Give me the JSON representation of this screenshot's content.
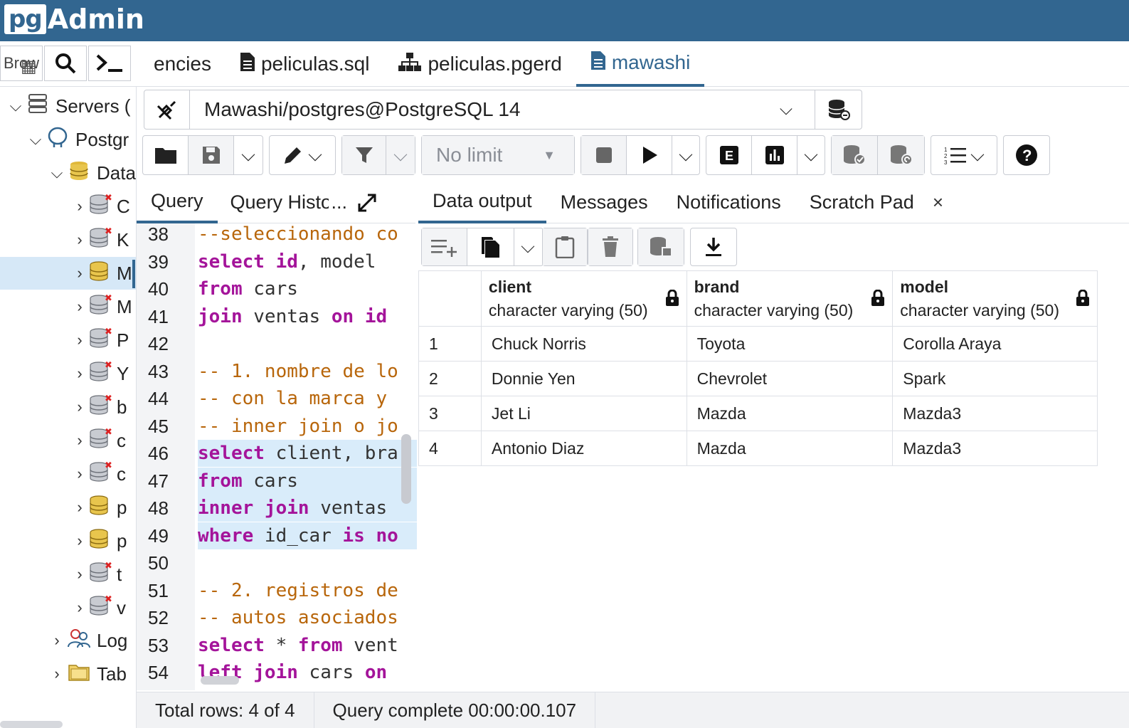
{
  "app": {
    "logo_pg": "pg",
    "logo_admin": "Admin"
  },
  "left_tools": {
    "browse_label": "Brow"
  },
  "tabs": [
    {
      "label": "encies",
      "icon": "none"
    },
    {
      "label": "peliculas.sql",
      "icon": "file-icon"
    },
    {
      "label": "peliculas.pgerd",
      "icon": "erd-icon"
    },
    {
      "label": "mawashi",
      "icon": "file-icon",
      "active": true
    }
  ],
  "tree": [
    {
      "label": "Servers ("
    },
    {
      "label": "Postgr"
    },
    {
      "label": "Data"
    },
    {
      "label": "C"
    },
    {
      "label": "K"
    },
    {
      "label": "M"
    },
    {
      "label": "M"
    },
    {
      "label": "P"
    },
    {
      "label": "Y"
    },
    {
      "label": "b"
    },
    {
      "label": "c"
    },
    {
      "label": "c"
    },
    {
      "label": "p"
    },
    {
      "label": "p"
    },
    {
      "label": "t"
    },
    {
      "label": "v"
    },
    {
      "label": "Log"
    },
    {
      "label": "Tab"
    }
  ],
  "connection": {
    "text": "Mawashi/postgres@PostgreSQL 14"
  },
  "toolbar": {
    "limit_label": "No limit"
  },
  "query_tabs": {
    "query": "Query",
    "history": "Query Histor",
    "more": "..."
  },
  "editor": {
    "lines": [
      {
        "n": "38",
        "parts": [
          {
            "t": "--seleccionando co",
            "c": "cm"
          }
        ]
      },
      {
        "n": "39",
        "parts": [
          {
            "t": "select ",
            "c": "kw"
          },
          {
            "t": "id",
            "c": "kw"
          },
          {
            "t": ", model",
            "c": "plain"
          }
        ]
      },
      {
        "n": "40",
        "parts": [
          {
            "t": "from ",
            "c": "kw"
          },
          {
            "t": "cars",
            "c": "plain"
          }
        ]
      },
      {
        "n": "41",
        "parts": [
          {
            "t": "join ",
            "c": "kw"
          },
          {
            "t": "ventas ",
            "c": "plain"
          },
          {
            "t": "on ",
            "c": "kw"
          },
          {
            "t": "id",
            "c": "kw"
          }
        ]
      },
      {
        "n": "42",
        "parts": []
      },
      {
        "n": "43",
        "parts": [
          {
            "t": "-- 1. nombre de lo",
            "c": "cm"
          }
        ]
      },
      {
        "n": "44",
        "parts": [
          {
            "t": "-- con la marca y",
            "c": "cm"
          }
        ]
      },
      {
        "n": "45",
        "parts": [
          {
            "t": "-- inner join o jo",
            "c": "cm"
          }
        ]
      },
      {
        "n": "46",
        "hl": true,
        "parts": [
          {
            "t": "select ",
            "c": "kw"
          },
          {
            "t": "client, bra",
            "c": "plain"
          }
        ]
      },
      {
        "n": "47",
        "hl": true,
        "parts": [
          {
            "t": "from ",
            "c": "kw"
          },
          {
            "t": "cars",
            "c": "plain"
          }
        ]
      },
      {
        "n": "48",
        "hl": true,
        "parts": [
          {
            "t": "inner join ",
            "c": "kw"
          },
          {
            "t": "ventas",
            "c": "plain"
          }
        ]
      },
      {
        "n": "49",
        "hl": true,
        "parts": [
          {
            "t": "where ",
            "c": "kw"
          },
          {
            "t": "id_car ",
            "c": "plain"
          },
          {
            "t": "is no",
            "c": "kw"
          }
        ]
      },
      {
        "n": "50",
        "parts": []
      },
      {
        "n": "51",
        "parts": [
          {
            "t": "-- 2. registros de",
            "c": "cm"
          }
        ]
      },
      {
        "n": "52",
        "parts": [
          {
            "t": "-- autos asociados",
            "c": "cm"
          }
        ]
      },
      {
        "n": "53",
        "parts": [
          {
            "t": "select ",
            "c": "kw"
          },
          {
            "t": "* ",
            "c": "plain"
          },
          {
            "t": "from ",
            "c": "kw"
          },
          {
            "t": "vent",
            "c": "plain"
          }
        ]
      },
      {
        "n": "54",
        "parts": [
          {
            "t": "left join ",
            "c": "kw"
          },
          {
            "t": "cars ",
            "c": "plain"
          },
          {
            "t": "on",
            "c": "kw"
          }
        ]
      }
    ]
  },
  "result_tabs": {
    "data_output": "Data output",
    "messages": "Messages",
    "notifications": "Notifications",
    "scratch_pad": "Scratch Pad",
    "close": "×"
  },
  "grid": {
    "columns": [
      {
        "name": "client",
        "type": "character varying (50)"
      },
      {
        "name": "brand",
        "type": "character varying (50)"
      },
      {
        "name": "model",
        "type": "character varying (50)"
      }
    ],
    "rows": [
      {
        "n": "1",
        "cells": [
          "Chuck Norris",
          "Toyota",
          "Corolla Araya"
        ]
      },
      {
        "n": "2",
        "cells": [
          "Donnie Yen",
          "Chevrolet",
          "Spark"
        ]
      },
      {
        "n": "3",
        "cells": [
          "Jet Li",
          "Mazda",
          "Mazda3"
        ]
      },
      {
        "n": "4",
        "cells": [
          "Antonio Diaz",
          "Mazda",
          "Mazda3"
        ]
      }
    ]
  },
  "status": {
    "rows": "Total rows: 4 of 4",
    "query": "Query complete 00:00:00.107"
  },
  "colors": {
    "header": "#326690",
    "keyword": "#a4149a",
    "comment": "#b8660b",
    "highlight": "#d9ecfa"
  }
}
